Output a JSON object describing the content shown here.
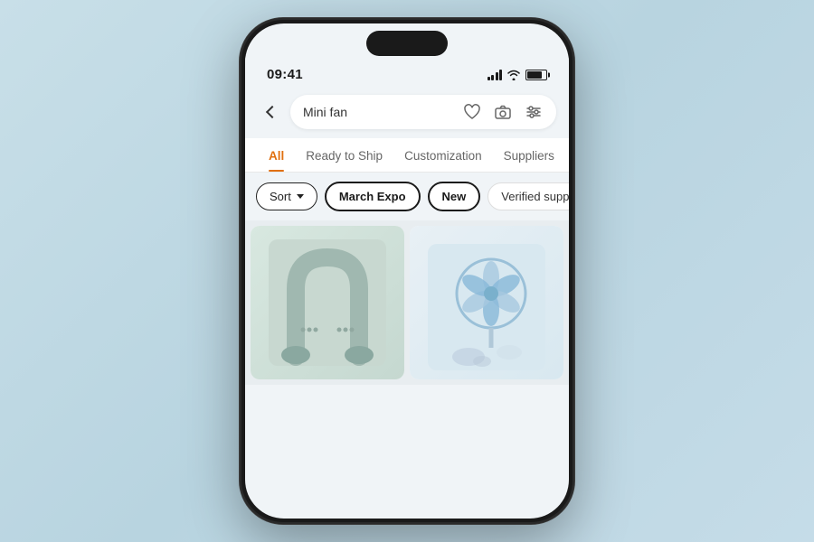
{
  "phone": {
    "status_time": "09:41",
    "screen_bg": "#f0f4f7"
  },
  "search": {
    "query": "Mini fan",
    "back_label": "back",
    "placeholder": "Mini fan"
  },
  "tabs": [
    {
      "id": "all",
      "label": "All",
      "active": true
    },
    {
      "id": "ready_to_ship",
      "label": "Ready to Ship",
      "active": false
    },
    {
      "id": "customization",
      "label": "Customization",
      "active": false
    },
    {
      "id": "suppliers",
      "label": "Suppliers",
      "active": false
    }
  ],
  "filter_chips": [
    {
      "id": "sort",
      "label": "Sort",
      "type": "sort"
    },
    {
      "id": "march_expo",
      "label": "March Expo",
      "type": "active"
    },
    {
      "id": "new",
      "label": "New",
      "type": "active"
    },
    {
      "id": "verified",
      "label": "Verified supplie…",
      "type": "default"
    }
  ],
  "icons": {
    "heart": "♡",
    "camera": "⊡",
    "filter": "⊞",
    "back_arrow": "‹"
  }
}
